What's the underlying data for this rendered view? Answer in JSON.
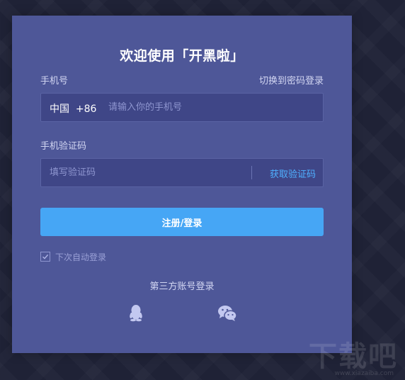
{
  "login": {
    "title": "欢迎使用「开黑啦」",
    "phone_label": "手机号",
    "switch_link": "切换到密码登录",
    "country": "中国",
    "country_code": "+86",
    "phone_placeholder": "请输入你的手机号",
    "code_label": "手机验证码",
    "code_placeholder": "填写验证码",
    "get_code": "获取验证码",
    "submit": "注册/登录",
    "auto_login": "下次自动登录",
    "auto_login_checked": true,
    "third_party": "第三方账号登录",
    "icons": [
      "qq-icon",
      "wechat-icon"
    ]
  },
  "watermark": {
    "text": "下载吧",
    "url": "www.xiazaiba.com"
  },
  "colors": {
    "page_bg": "#1f2236",
    "panel_bg": "#4e5798",
    "field_bg": "#3f4687",
    "accent": "#46a6f5",
    "link": "#4fb0ff"
  }
}
